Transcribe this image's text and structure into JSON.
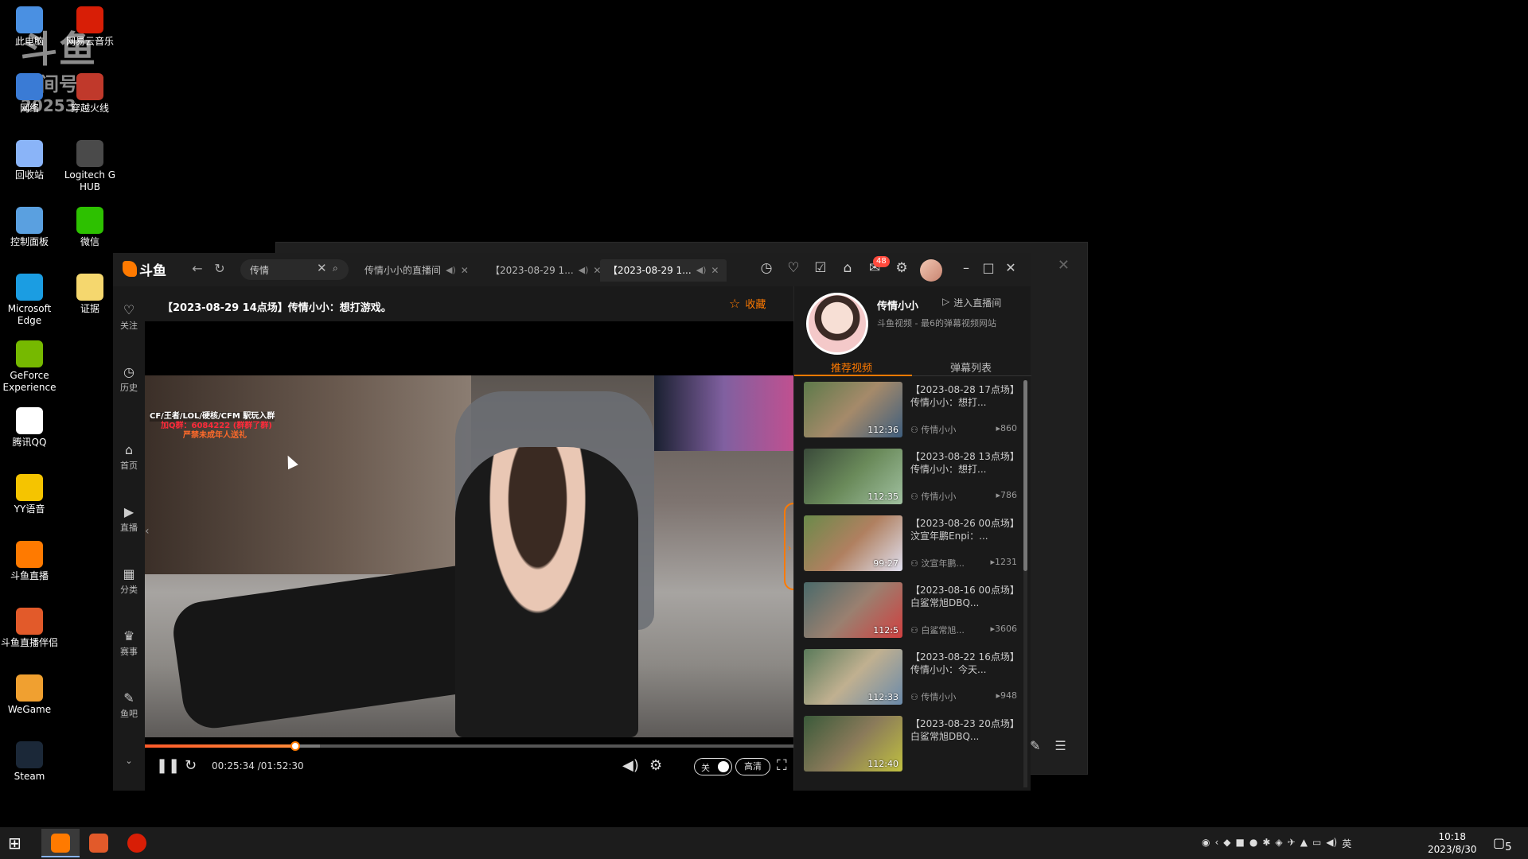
{
  "desktop": {
    "icons_col1": [
      {
        "label": "此电脑",
        "icon": "computer-icon"
      },
      {
        "label": "网络",
        "icon": "network-icon"
      },
      {
        "label": "回收站",
        "icon": "recycle-bin-icon"
      },
      {
        "label": "控制面板",
        "icon": "control-panel-icon"
      },
      {
        "label": "Microsoft Edge",
        "icon": "edge-icon"
      },
      {
        "label": "GeForce Experience",
        "icon": "geforce-icon"
      },
      {
        "label": "腾讯QQ",
        "icon": "qq-icon"
      },
      {
        "label": "YY语音",
        "icon": "yy-icon"
      },
      {
        "label": "斗鱼直播",
        "icon": "douyu-icon"
      },
      {
        "label": "斗鱼直播伴侣",
        "icon": "douyu-companion-icon"
      },
      {
        "label": "WeGame",
        "icon": "wegame-icon"
      },
      {
        "label": "Steam",
        "icon": "steam-icon"
      }
    ],
    "icons_col2": [
      {
        "label": "网易云音乐",
        "icon": "netease-music-icon"
      },
      {
        "label": "穿越火线",
        "icon": "crossfire-icon"
      },
      {
        "label": "Logitech G HUB",
        "icon": "logitech-icon"
      },
      {
        "label": "微信",
        "icon": "wechat-icon"
      },
      {
        "label": "证据",
        "icon": "folder-icon"
      }
    ],
    "watermark": {
      "line1": "斗鱼",
      "line2": "房间号",
      "line3": "20253"
    }
  },
  "app": {
    "logo": "斗鱼",
    "search_value": "传情",
    "tabs": [
      {
        "label": "传情小小的直播间"
      },
      {
        "label": "【2023-08-29 1..."
      },
      {
        "label": "【2023-08-29 1..."
      }
    ],
    "badge": "48",
    "sidebar": [
      {
        "label": "关注",
        "icon": "heart-icon"
      },
      {
        "label": "历史",
        "icon": "clock-icon"
      },
      {
        "label": "首页",
        "icon": "home-icon"
      },
      {
        "label": "直播",
        "icon": "live-icon"
      },
      {
        "label": "分类",
        "icon": "grid-icon"
      },
      {
        "label": "赛事",
        "icon": "trophy-icon"
      },
      {
        "label": "鱼吧",
        "icon": "forum-icon"
      }
    ],
    "video_title": "【2023-08-29 14点场】传情小小：想打游戏。",
    "favorite_label": "收藏",
    "overlay": {
      "line1": "CF/王者/LOL/硬核/CFM 駅玩入群",
      "line2": "加Q群：6084222 (群群了群)",
      "line3": "严禁未成年人送礼"
    },
    "player": {
      "current_time": "00:25:34",
      "total_time": "/01:52:30",
      "progress_fraction": 0.232,
      "buffered_fraction": 0.27,
      "danmaku_toggle": "关",
      "quality": "高清"
    }
  },
  "right_panel": {
    "streamer_name": "传情小小",
    "enter_room": "进入直播间",
    "subtitle": "斗鱼视频 - 最6的弹幕视频网站",
    "tabs": [
      "推荐视频",
      "弹幕列表"
    ],
    "videos": [
      {
        "title": "【2023-08-28 17点场】传情小小：想打...",
        "author": "传情小小",
        "views": "860",
        "duration": "112:36"
      },
      {
        "title": "【2023-08-28 13点场】传情小小：想打...",
        "author": "传情小小",
        "views": "786",
        "duration": "112:35"
      },
      {
        "title": "【2023-08-26 00点场】汶宣年鹏Enpi：...",
        "author": "汶宣年鹏...",
        "views": "1231",
        "duration": "99:27"
      },
      {
        "title": "【2023-08-16 00点场】白鲨常旭DBQ...",
        "author": "白鲨常旭...",
        "views": "3606",
        "duration": "112:5"
      },
      {
        "title": "【2023-08-22 16点场】传情小小：今天...",
        "author": "传情小小",
        "views": "948",
        "duration": "112:33"
      },
      {
        "title": "【2023-08-23 20点场】白鲨常旭DBQ...",
        "author": "",
        "views": "",
        "duration": "112:40"
      }
    ]
  },
  "taskbar": {
    "time": "10:18",
    "date": "2023/8/30",
    "ime": "英",
    "notifications": "5"
  }
}
